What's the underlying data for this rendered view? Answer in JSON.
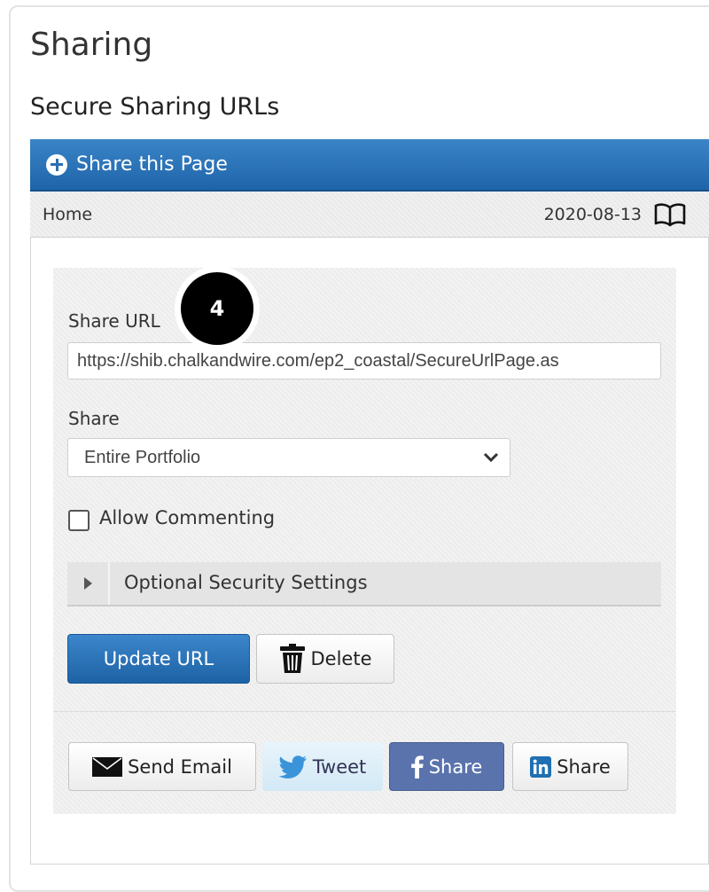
{
  "page": {
    "title": "Sharing",
    "subtitle": "Secure Sharing URLs"
  },
  "panel": {
    "header_label": "Share this Page",
    "breadcrumb": "Home",
    "date": "2020-08-13"
  },
  "form": {
    "share_url_label": "Share URL",
    "share_url_value": "https://shib.chalkandwire.com/ep2_coastal/SecureUrlPage.as",
    "share_label": "Share",
    "share_selected": "Entire Portfolio",
    "allow_commenting_label": "Allow Commenting",
    "allow_commenting_checked": false,
    "optional_security_label": "Optional Security Settings",
    "update_button": "Update URL",
    "delete_button": "Delete"
  },
  "share_buttons": {
    "email": "Send Email",
    "tweet": "Tweet",
    "facebook": "Share",
    "linkedin": "Share"
  },
  "annotation": {
    "step_number": "4"
  },
  "colors": {
    "primary": "#1f64a8",
    "facebook": "#5a73ad",
    "tweet_bg": "#d3e9f6"
  },
  "icons": [
    "plus-circle-icon",
    "book-icon",
    "chevron-down-icon",
    "caret-right-icon",
    "trash-icon",
    "envelope-icon",
    "twitter-bird-icon",
    "facebook-icon",
    "linkedin-icon"
  ]
}
